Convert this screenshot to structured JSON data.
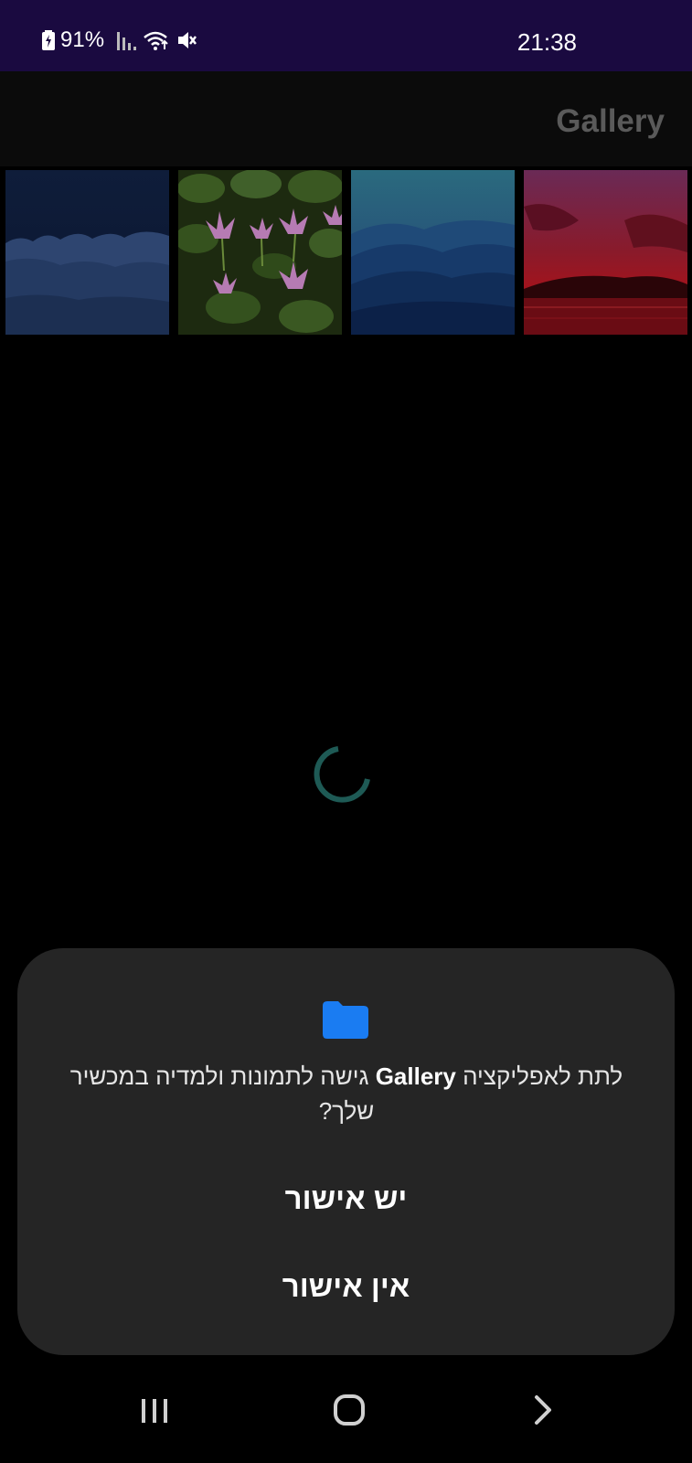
{
  "status_bar": {
    "battery": "91%",
    "time": "21:38",
    "icons": [
      "battery-charging-icon",
      "signal-icon",
      "wifi-icon",
      "mute-icon"
    ],
    "background": "#1a0a40"
  },
  "app_bar": {
    "title": "Gallery"
  },
  "thumbnails": [
    {
      "name": "thumbnail-snowy-forest"
    },
    {
      "name": "thumbnail-water-lilies"
    },
    {
      "name": "thumbnail-blue-mountains"
    },
    {
      "name": "thumbnail-sunset"
    }
  ],
  "loading": {
    "spinner_color": "#1e5a55"
  },
  "dialog": {
    "message_prefix": "לתת לאפליקציה ",
    "app_name": "Gallery",
    "message_suffix": " גישה לתמונות ולמדיה במכשיר שלך?",
    "allow_label": "יש אישור",
    "deny_label": "אין אישור",
    "icon": "folder-icon",
    "accent": "#1a7cf2"
  },
  "nav_bar": {
    "recents": "recents-icon",
    "home": "home-icon",
    "back": "back-icon"
  }
}
